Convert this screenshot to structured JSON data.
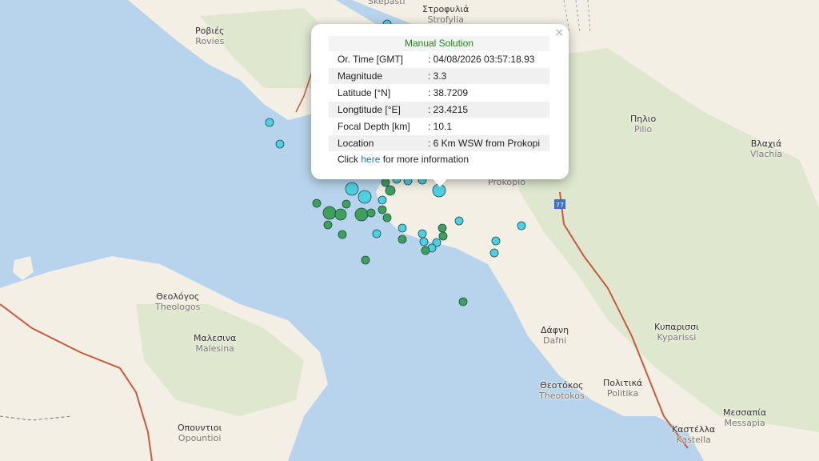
{
  "popup": {
    "title": "Manual Solution",
    "close_symbol": "×",
    "rows": [
      {
        "label": "Or. Time [GMT]",
        "value": ": 04/08/2026 03:57:18.93"
      },
      {
        "label": "Magnitude",
        "value": ": 3.3"
      },
      {
        "label": "Latitude [°N]",
        "value": ": 38.7209"
      },
      {
        "label": "Longtitude [°E]",
        "value": ": 23.4215"
      },
      {
        "label": "Focal Depth [km]",
        "value": ": 10.1"
      },
      {
        "label": "Location",
        "value": ": 6 Km WSW from Prokopi"
      }
    ],
    "more_prefix": "Click",
    "more_link": "here",
    "more_suffix": "for more information"
  },
  "places": {
    "skepasti": {
      "latin": "Skepasti"
    },
    "strofylia": {
      "greek": "Στροφυλιά",
      "latin": "Strofylia"
    },
    "rovies": {
      "greek": "Ροβιές",
      "latin": "Rovies"
    },
    "pilio": {
      "greek": "Πηλιο",
      "latin": "Pilio"
    },
    "vlachia": {
      "greek": "Βλαχιά",
      "latin": "Vlachia"
    },
    "prokopio": {
      "latin": "Prokopio"
    },
    "theologos": {
      "greek": "Θεολόγος",
      "latin": "Theologos"
    },
    "malesina": {
      "greek": "Μαλεσινα",
      "latin": "Malesina"
    },
    "dafni": {
      "greek": "Δάφνη",
      "latin": "Dafni"
    },
    "kyparissi": {
      "greek": "Κυπαρισσι",
      "latin": "Kyparissi"
    },
    "theotokos": {
      "greek": "Θεοτόκος",
      "latin": "Theotokos"
    },
    "politika": {
      "greek": "Πολιτικά",
      "latin": "Politika"
    },
    "messapia": {
      "greek": "Μεσσαπία",
      "latin": "Messapia"
    },
    "opountioi": {
      "greek": "Οπουντιοι",
      "latin": "Opountioi"
    },
    "kastella": {
      "greek": "Καστέλλα",
      "latin": "Kastella"
    }
  },
  "road_shield": "77",
  "colors": {
    "water": "#b8d4ec",
    "land": "#f3efe4",
    "relief": "#dfe8cf",
    "road": "#c85a3c",
    "quake_recent": "#4fd0e0",
    "quake_older": "#3fa05a",
    "popup_title": "#1a8a1a"
  },
  "events": [
    {
      "mag": 3.3,
      "age": "recent",
      "lat": 38.7209,
      "lon": 23.4215
    }
  ]
}
